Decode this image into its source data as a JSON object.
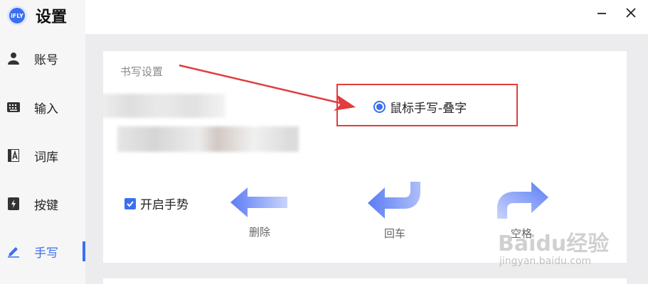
{
  "app": {
    "logo_text": "iFLY",
    "title": "设置"
  },
  "sidebar": {
    "items": [
      {
        "label": "账号",
        "icon": "user-icon"
      },
      {
        "label": "输入",
        "icon": "keyboard-icon"
      },
      {
        "label": "词库",
        "icon": "dictionary-icon"
      },
      {
        "label": "按键",
        "icon": "key-icon"
      },
      {
        "label": "手写",
        "icon": "pen-icon",
        "active": true
      }
    ]
  },
  "window": {
    "minimize_icon": "minimize-icon",
    "close_icon": "close-icon"
  },
  "handwriting": {
    "section_title": "书写设置",
    "mode_option": "鼠标手写-叠字",
    "mode_selected": true,
    "gesture_checkbox": "开启手势",
    "gesture_checked": true,
    "gestures": [
      {
        "label": "删除",
        "icon": "arrow-left-icon"
      },
      {
        "label": "回车",
        "icon": "return-arrow-icon"
      },
      {
        "label": "空格",
        "icon": "arrow-right-up-icon"
      }
    ]
  },
  "colors": {
    "accent": "#3a6ff0",
    "annotation": "#e13d3d"
  },
  "watermark": {
    "text": "Baidu经验",
    "url": "jingyan.baidu.com"
  }
}
